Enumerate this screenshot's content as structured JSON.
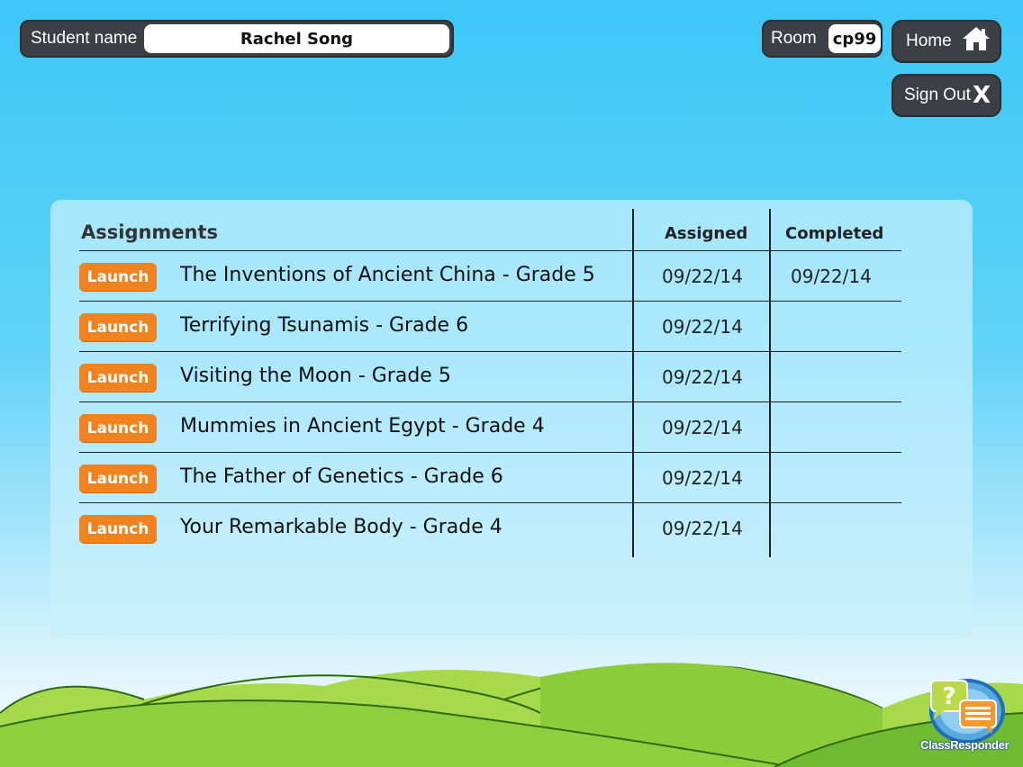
{
  "student": {
    "label": "Student name",
    "name": "Rachel Song"
  },
  "room": {
    "label": "Room",
    "code": "cp99"
  },
  "buttons": {
    "home": "Home",
    "sign_out": "Sign Out",
    "sign_out_glyph": "X"
  },
  "table": {
    "headers": {
      "assignments": "Assignments",
      "assigned": "Assigned",
      "completed": "Completed"
    },
    "launch_label": "Launch",
    "rows": [
      {
        "title": "The Inventions of Ancient China - Grade 5",
        "assigned": "09/22/14",
        "completed": "09/22/14"
      },
      {
        "title": "Terrifying Tsunamis - Grade 6",
        "assigned": "09/22/14",
        "completed": ""
      },
      {
        "title": "Visiting the Moon - Grade 5",
        "assigned": "09/22/14",
        "completed": ""
      },
      {
        "title": "Mummies in Ancient Egypt - Grade 4",
        "assigned": "09/22/14",
        "completed": ""
      },
      {
        "title": "The Father of Genetics - Grade 6",
        "assigned": "09/22/14",
        "completed": ""
      },
      {
        "title": "Your Remarkable Body - Grade 4",
        "assigned": "09/22/14",
        "completed": ""
      }
    ]
  },
  "logo": {
    "text": "ClassResponder",
    "icon": "classresponder-logo-icon"
  },
  "icons": {
    "home": "home-icon",
    "sign_out": "close-icon"
  },
  "colors": {
    "launch": "#f0831f",
    "dark_pill": "#3c3f44",
    "sky": "#3dc8f7",
    "grass": "#7cc23a"
  }
}
